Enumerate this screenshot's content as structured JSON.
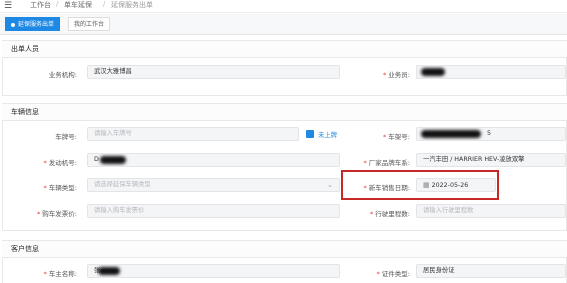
{
  "topbar": {
    "menu_icon": "hamburger-icon",
    "crumbs": [
      "工作台",
      "单车延保",
      "延保服务出单"
    ]
  },
  "tabs": [
    {
      "label": "延保服务出单",
      "active": true
    },
    {
      "label": "我的工作台",
      "active": false
    }
  ],
  "sections": {
    "issuer": {
      "title": "出单人员",
      "org_label": "业务机构:",
      "org_value": "武汉大雅博昌",
      "salesman_label": "业务员:"
    },
    "vehicle": {
      "title": "车辆信息",
      "plate_label": "车牌号:",
      "plate_placeholder": "请输入车牌号",
      "unregistered_label": "未上牌",
      "vin_label": "车架号:",
      "vin_suffix": "5",
      "engine_label": "发动机号:",
      "engine_prefix": "D",
      "brand_label": "厂家品牌车系:",
      "brand_value": "一汽丰田 / HARRIER HEV-凌放双擎",
      "type_label": "车辆类型:",
      "type_placeholder": "请选择延保车辆类型",
      "sale_date_label": "新车销售日期:",
      "sale_date_value": "2022-05-26",
      "price_label": "购车发票价:",
      "price_placeholder": "请输入购车发票价",
      "mileage_label": "行驶里程数:",
      "mileage_placeholder": "请输入行驶里程数"
    },
    "customer": {
      "title": "客户信息",
      "owner_label": "车主名称:",
      "owner_prefix": "张",
      "id_type_label": "证件类型:",
      "id_type_value": "居民身份证"
    }
  },
  "colors": {
    "accent": "#1e88e5",
    "required": "#e53935",
    "highlight": "#c62828"
  }
}
